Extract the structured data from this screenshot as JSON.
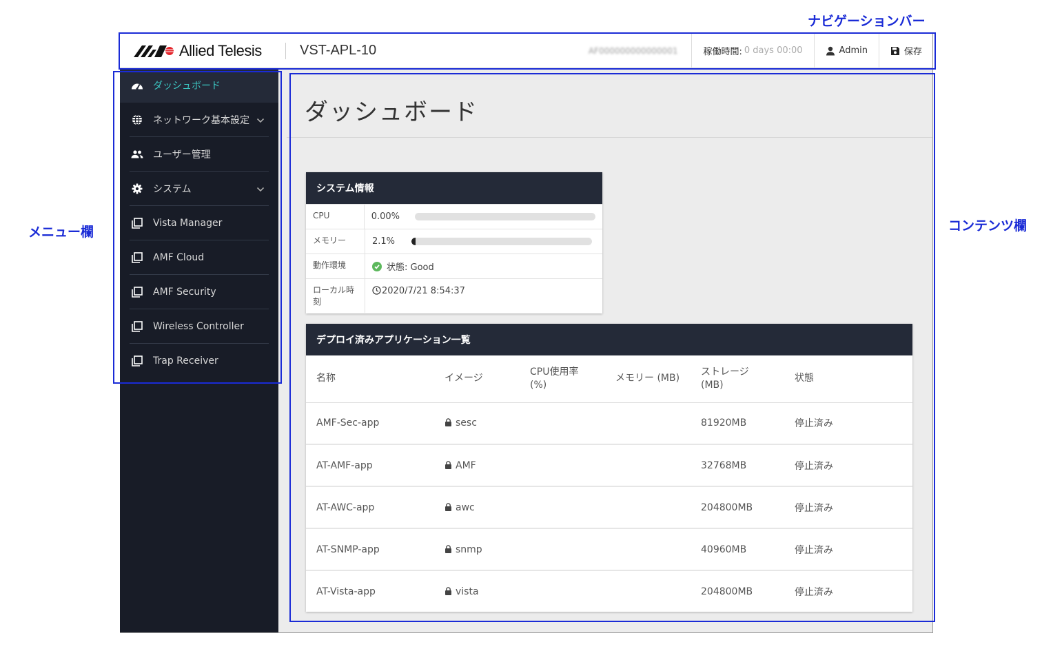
{
  "annotations": {
    "navbar": "ナビゲーションバー",
    "menu": "メニュー欄",
    "content": "コンテンツ欄"
  },
  "header": {
    "brand": "Allied Telesis",
    "device_name": "VST-APL-10",
    "serial_redacted": "AF000000000000001",
    "uptime_label": "稼働時間:",
    "uptime_value": "0 days 00:00",
    "user_label": "Admin",
    "save_label": "保存",
    "icons": {
      "user": "user-icon",
      "save": "floppy-disk-icon"
    }
  },
  "sidebar": {
    "items": [
      {
        "label": "ダッシュボード",
        "icon": "dashboard-gauge-icon",
        "active": true
      },
      {
        "label": "ネットワーク基本設定",
        "icon": "globe-icon",
        "expandable": true
      },
      {
        "label": "ユーザー管理",
        "icon": "users-icon"
      },
      {
        "label": "システム",
        "icon": "gear-icon",
        "expandable": true
      },
      {
        "label": "Vista Manager",
        "icon": "app-window-icon"
      },
      {
        "label": "AMF Cloud",
        "icon": "app-window-icon"
      },
      {
        "label": "AMF Security",
        "icon": "app-window-icon"
      },
      {
        "label": "Wireless Controller",
        "icon": "app-window-icon"
      },
      {
        "label": "Trap Receiver",
        "icon": "app-window-icon"
      }
    ]
  },
  "main": {
    "page_title": "ダッシュボード",
    "system_info": {
      "title": "システム情報",
      "cpu_label": "CPU",
      "cpu_value": "0.00%",
      "cpu_fraction": 0.0,
      "memory_label": "メモリー",
      "memory_value": "2.1%",
      "memory_fraction": 0.021,
      "env_label": "動作環境",
      "env_value": "状態: Good",
      "time_label": "ローカル時刻",
      "time_value": "2020/7/21 8:54:37"
    },
    "apps": {
      "title": "デプロイ済みアプリケーション一覧",
      "columns": [
        "名称",
        "イメージ",
        "CPU使用率 (%)",
        "メモリー (MB)",
        "ストレージ (MB)",
        "状態"
      ],
      "rows": [
        {
          "name": "AMF-Sec-app",
          "image": "sesc",
          "cpu": "",
          "memory": "",
          "storage": "81920MB",
          "status": "停止済み"
        },
        {
          "name": "AT-AMF-app",
          "image": "AMF",
          "cpu": "",
          "memory": "",
          "storage": "32768MB",
          "status": "停止済み"
        },
        {
          "name": "AT-AWC-app",
          "image": "awc",
          "cpu": "",
          "memory": "",
          "storage": "204800MB",
          "status": "停止済み"
        },
        {
          "name": "AT-SNMP-app",
          "image": "snmp",
          "cpu": "",
          "memory": "",
          "storage": "40960MB",
          "status": "停止済み"
        },
        {
          "name": "AT-Vista-app",
          "image": "vista",
          "cpu": "",
          "memory": "",
          "storage": "204800MB",
          "status": "停止済み"
        }
      ]
    }
  },
  "colors": {
    "annotation_blue": "#1a2bd6",
    "sidebar_bg": "#181c27",
    "active_accent": "#3cc7c3",
    "status_good": "#5cb85c",
    "panel_header": "#242a38"
  }
}
